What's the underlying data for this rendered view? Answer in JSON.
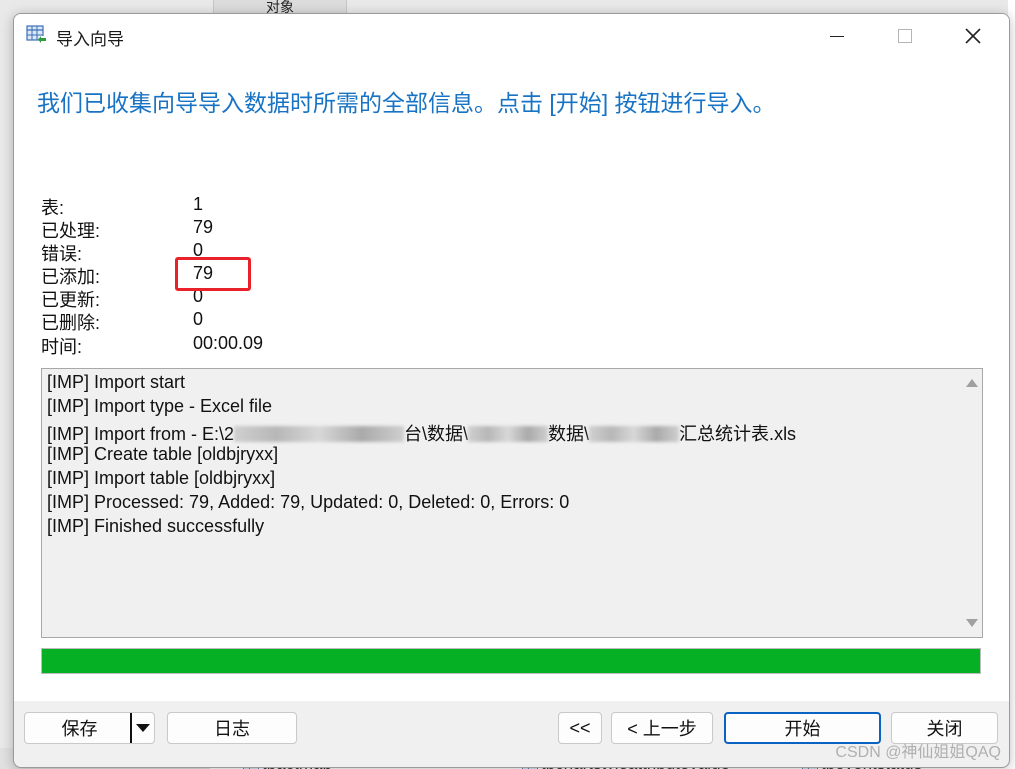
{
  "background": {
    "top_tab": "对象",
    "bottom_items": [
      "tbactmap",
      "tbchartstyleattributevalue",
      "tbeventstatus"
    ],
    "watermark": "CSDN @神仙姐姐QAQ"
  },
  "window": {
    "title": "导入向导",
    "minimize_icon": "minimize-icon",
    "maximize_icon": "maximize-icon",
    "close_icon": "close-icon"
  },
  "header": {
    "message": "我们已收集向导导入数据时所需的全部信息。点击 [开始] 按钮进行导入。"
  },
  "stats": [
    {
      "label": "表:",
      "value": "1"
    },
    {
      "label": "已处理:",
      "value": "79"
    },
    {
      "label": "错误:",
      "value": "0"
    },
    {
      "label": "已添加:",
      "value": "79"
    },
    {
      "label": "已更新:",
      "value": "0"
    },
    {
      "label": "已删除:",
      "value": "0"
    },
    {
      "label": "时间:",
      "value": "00:00.09"
    }
  ],
  "log": {
    "lines": [
      "[IMP] Import start",
      "[IMP] Import type - Excel file",
      "[IMP] Create table [oldbjryxx]",
      "[IMP] Import table [oldbjryxx]",
      "[IMP] Processed: 79, Added: 79, Updated: 0, Deleted: 0, Errors: 0",
      "[IMP] Finished successfully"
    ],
    "import_from": {
      "prefix": "[IMP] Import from - E:\\2",
      "seg1": "台\\数据\\",
      "seg2": "数据\\",
      "seg3": "汇总统计表.xls"
    }
  },
  "progress": {
    "percent": 100,
    "color": "#06b025"
  },
  "buttons": {
    "save": "保存",
    "log": "日志",
    "first": "<<",
    "back": "< 上一步",
    "start": "开始",
    "close": "关闭"
  },
  "colors": {
    "headline": "#1873c4",
    "highlight": "#e8212b",
    "primary_border": "#0a62c2"
  }
}
